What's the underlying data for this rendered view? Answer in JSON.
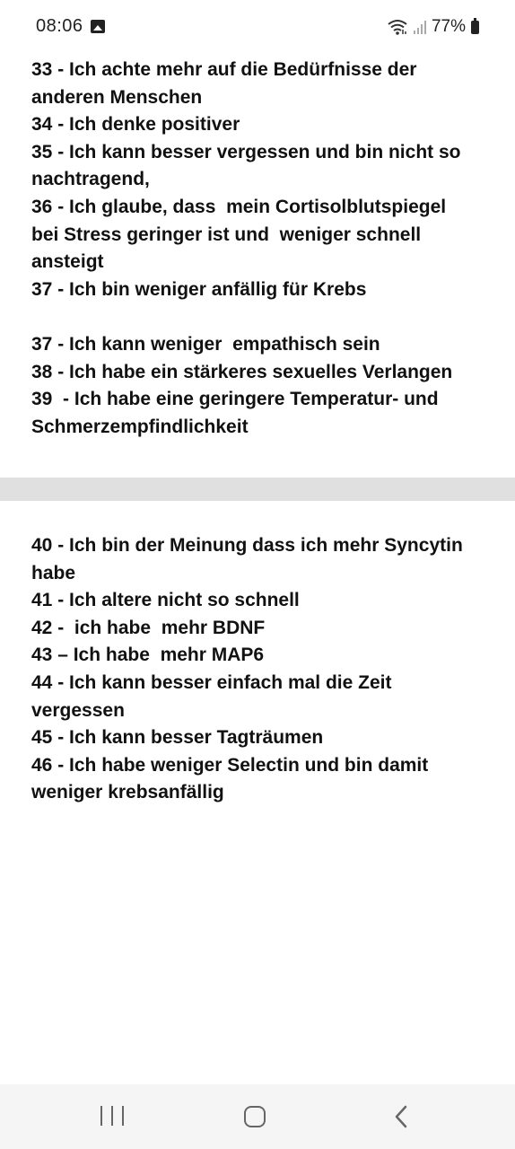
{
  "status_bar": {
    "time": "08:06",
    "battery": "77%",
    "icons": [
      "gallery-icon",
      "wifi-icon",
      "signal-icon",
      "battery-icon"
    ]
  },
  "card1": {
    "lines": [
      "33 - Ich achte mehr auf die Bedürfnisse der",
      "anderen Menschen",
      "34 - Ich denke positiver",
      "35 - Ich kann besser vergessen und bin nicht so",
      "nachtragend,",
      "36 - Ich glaube, dass  mein Cortisolblutspiegel",
      "bei Stress geringer ist und  weniger schnell",
      "ansteigt",
      "37 - Ich bin weniger anfällig für Krebs",
      "",
      "37 - Ich kann weniger  empathisch sein",
      "38 - Ich habe ein stärkeres sexuelles Verlangen",
      "39  - Ich habe eine geringere Temperatur- und",
      "Schmerzempfindlichkeit"
    ]
  },
  "card2": {
    "lines": [
      "40 - Ich bin der Meinung dass ich mehr Syncytin",
      "habe",
      "41 - Ich altere nicht so schnell",
      "42 -  ich habe  mehr BDNF",
      "43 – Ich habe  mehr MAP6",
      "44 - Ich kann besser einfach mal die Zeit",
      "vergessen",
      "45 - Ich kann besser Tagträumen",
      "46 - Ich habe weniger Selectin und bin damit",
      "weniger krebsanfällig"
    ]
  },
  "navigation": {
    "icons": [
      "recents-icon",
      "home-icon",
      "back-icon"
    ]
  },
  "colors": {
    "text": "#111111",
    "divider": "#e0e0e0",
    "navbar": "#f5f5f5",
    "nav_icons": "#666666"
  }
}
